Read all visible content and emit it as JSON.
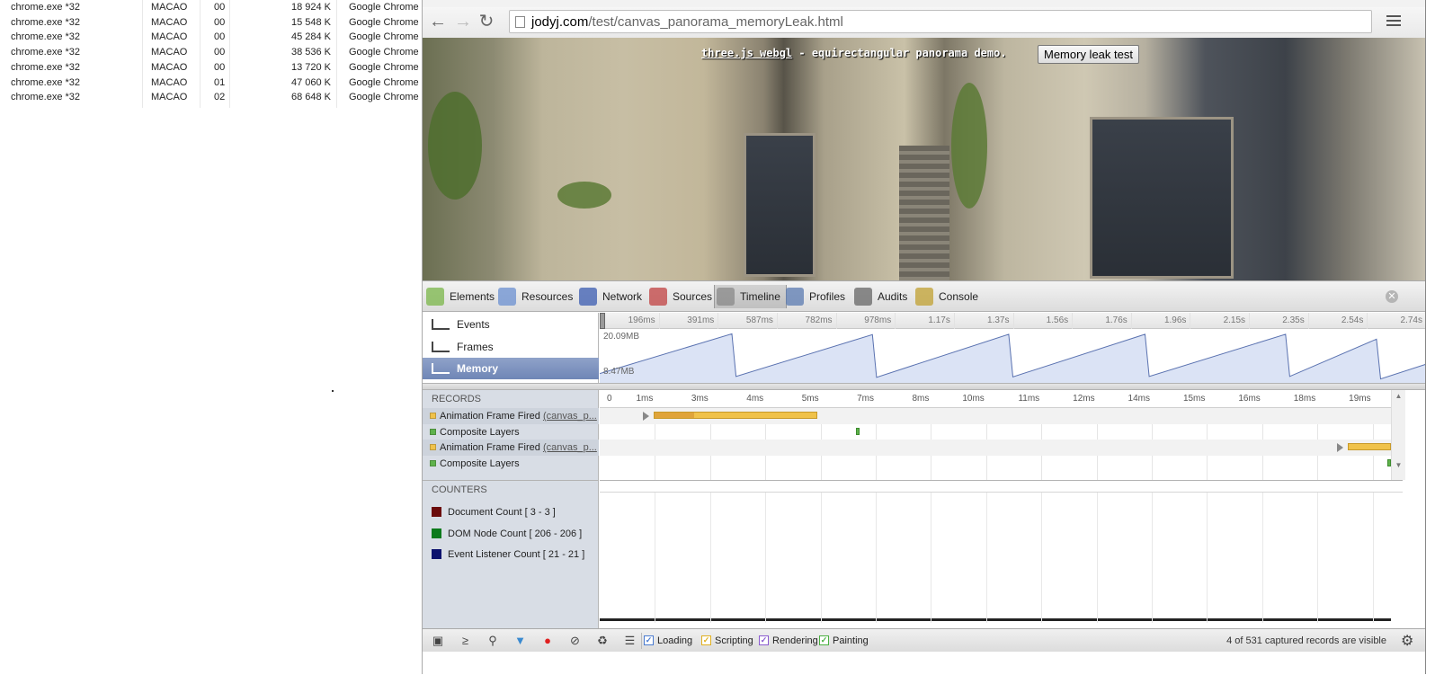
{
  "task_manager": {
    "rows": [
      {
        "name": "chrome.exe *32",
        "user": "MACAO",
        "cpu": "00",
        "memory": "18 924 K",
        "description": "Google Chrome"
      },
      {
        "name": "chrome.exe *32",
        "user": "MACAO",
        "cpu": "00",
        "memory": "15 548 K",
        "description": "Google Chrome"
      },
      {
        "name": "chrome.exe *32",
        "user": "MACAO",
        "cpu": "00",
        "memory": "45 284 K",
        "description": "Google Chrome"
      },
      {
        "name": "chrome.exe *32",
        "user": "MACAO",
        "cpu": "00",
        "memory": "38 536 K",
        "description": "Google Chrome"
      },
      {
        "name": "chrome.exe *32",
        "user": "MACAO",
        "cpu": "00",
        "memory": "13 720 K",
        "description": "Google Chrome"
      },
      {
        "name": "chrome.exe *32",
        "user": "MACAO",
        "cpu": "01",
        "memory": "47 060 K",
        "description": "Google Chrome"
      },
      {
        "name": "chrome.exe *32",
        "user": "MACAO",
        "cpu": "02",
        "memory": "68 648 K",
        "description": "Google Chrome"
      }
    ]
  },
  "browser": {
    "url_host": "jodyj.com",
    "url_path": "/test/canvas_panorama_memoryLeak.html",
    "back_icon": "arrow-left-icon",
    "forward_icon": "arrow-right-icon",
    "reload_icon": "reload-icon",
    "star_icon": "star-icon",
    "menu_icon": "hamburger-menu-icon"
  },
  "page": {
    "title_link": "three.js webgl",
    "title_rest": " - equirectangular panorama demo.",
    "button_label": "Memory leak test"
  },
  "devtools": {
    "tabs": [
      {
        "label": "Elements",
        "icon": "elements-icon",
        "active": false
      },
      {
        "label": "Resources",
        "icon": "resources-icon",
        "active": false
      },
      {
        "label": "Network",
        "icon": "network-icon",
        "active": false
      },
      {
        "label": "Sources",
        "icon": "sources-icon",
        "active": false
      },
      {
        "label": "Timeline",
        "icon": "timeline-icon",
        "active": true
      },
      {
        "label": "Profiles",
        "icon": "profiles-icon",
        "active": false
      },
      {
        "label": "Audits",
        "icon": "audits-icon",
        "active": false
      },
      {
        "label": "Console",
        "icon": "console-icon",
        "active": false
      }
    ],
    "close_icon": "close-icon",
    "overview": {
      "items": [
        {
          "label": "Events",
          "icon": "events-icon",
          "selected": false
        },
        {
          "label": "Frames",
          "icon": "frames-icon",
          "selected": false
        },
        {
          "label": "Memory",
          "icon": "memory-icon",
          "selected": true
        }
      ],
      "ticks": [
        "196ms",
        "391ms",
        "587ms",
        "782ms",
        "978ms",
        "1.17s",
        "1.37s",
        "1.56s",
        "1.76s",
        "1.96s",
        "2.15s",
        "2.35s",
        "2.54s",
        "2.74s"
      ],
      "memory_max": "20.09MB",
      "memory_min": "8.47MB",
      "memory_series": [
        {
          "t": 0.0,
          "mb": 10.3
        },
        {
          "t": 0.16,
          "mb": 20.0
        },
        {
          "t": 0.165,
          "mb": 9.6
        },
        {
          "t": 0.33,
          "mb": 19.8
        },
        {
          "t": 0.335,
          "mb": 9.4
        },
        {
          "t": 0.495,
          "mb": 19.9
        },
        {
          "t": 0.5,
          "mb": 9.5
        },
        {
          "t": 0.66,
          "mb": 19.9
        },
        {
          "t": 0.665,
          "mb": 9.6
        },
        {
          "t": 0.83,
          "mb": 19.9
        },
        {
          "t": 0.835,
          "mb": 9.6
        },
        {
          "t": 0.94,
          "mb": 18.7
        },
        {
          "t": 0.945,
          "mb": 9.0
        },
        {
          "t": 1.0,
          "mb": 12.6
        }
      ],
      "fill_color": "#dbe3f5",
      "line_color": "#5a72b0"
    },
    "records": {
      "header": "RECORDS",
      "rows": [
        {
          "label": "Animation Frame Fired",
          "detail": "(canvas_p...",
          "color": "#f0c24a"
        },
        {
          "label": "Composite Layers",
          "detail": "",
          "color": "#5fb24c"
        },
        {
          "label": "Animation Frame Fired",
          "detail": "(canvas_p...",
          "color": "#f0c24a"
        },
        {
          "label": "Composite Layers",
          "detail": "",
          "color": "#5fb24c"
        }
      ],
      "ticks": [
        "0",
        "1ms",
        "3ms",
        "4ms",
        "5ms",
        "7ms",
        "8ms",
        "10ms",
        "11ms",
        "12ms",
        "14ms",
        "15ms",
        "16ms",
        "18ms",
        "19ms"
      ]
    },
    "counters": {
      "header": "COUNTERS",
      "items": [
        {
          "label": "Document Count [ 3 - 3 ]",
          "color": "#6b0c0c"
        },
        {
          "label": "DOM Node Count [ 206 - 206 ]",
          "color": "#0c7a1c"
        },
        {
          "label": "Event Listener Count [ 21 - 21 ]",
          "color": "#0c126e"
        }
      ]
    },
    "statusbar": {
      "buttons": [
        {
          "icon": "dock-icon"
        },
        {
          "icon": "console-drawer-icon"
        },
        {
          "icon": "search-icon"
        },
        {
          "icon": "filter-icon"
        },
        {
          "icon": "record-icon"
        },
        {
          "icon": "clear-icon"
        },
        {
          "icon": "garbage-collect-icon"
        },
        {
          "icon": "glue-events-icon"
        }
      ],
      "filters": [
        {
          "label": "Loading",
          "color": "#4a7bd0"
        },
        {
          "label": "Scripting",
          "color": "#e0b020"
        },
        {
          "label": "Rendering",
          "color": "#8a5ad0"
        },
        {
          "label": "Painting",
          "color": "#4ab040"
        }
      ],
      "status": "4 of 531 captured records are visible",
      "settings_icon": "gear-icon"
    }
  }
}
